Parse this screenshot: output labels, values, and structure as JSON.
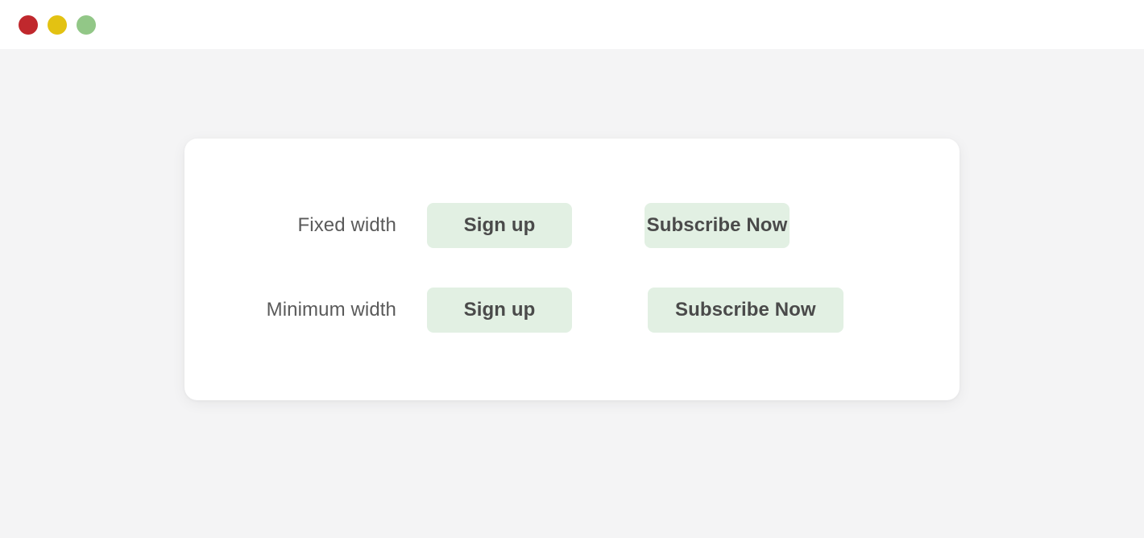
{
  "window": {
    "traffic_lights": [
      {
        "name": "close-button",
        "color": "#c0282d"
      },
      {
        "name": "minimize-button",
        "color": "#e3c212"
      },
      {
        "name": "zoom-button",
        "color": "#92c787"
      }
    ]
  },
  "theme": {
    "page_background": "#f4f4f5",
    "card_background": "#ffffff",
    "button_background": "#e2f0e3",
    "button_text_color": "#4a4a4a",
    "label_text_color": "#5a5a5a"
  },
  "card": {
    "rows": [
      {
        "label": "Fixed width",
        "buttons": [
          {
            "label": "Sign up",
            "mode": "fixed"
          },
          {
            "label": "Subscribe Now",
            "mode": "fixed"
          }
        ]
      },
      {
        "label": "Minimum width",
        "buttons": [
          {
            "label": "Sign up",
            "mode": "minimum"
          },
          {
            "label": "Subscribe Now",
            "mode": "minimum"
          }
        ]
      }
    ]
  }
}
